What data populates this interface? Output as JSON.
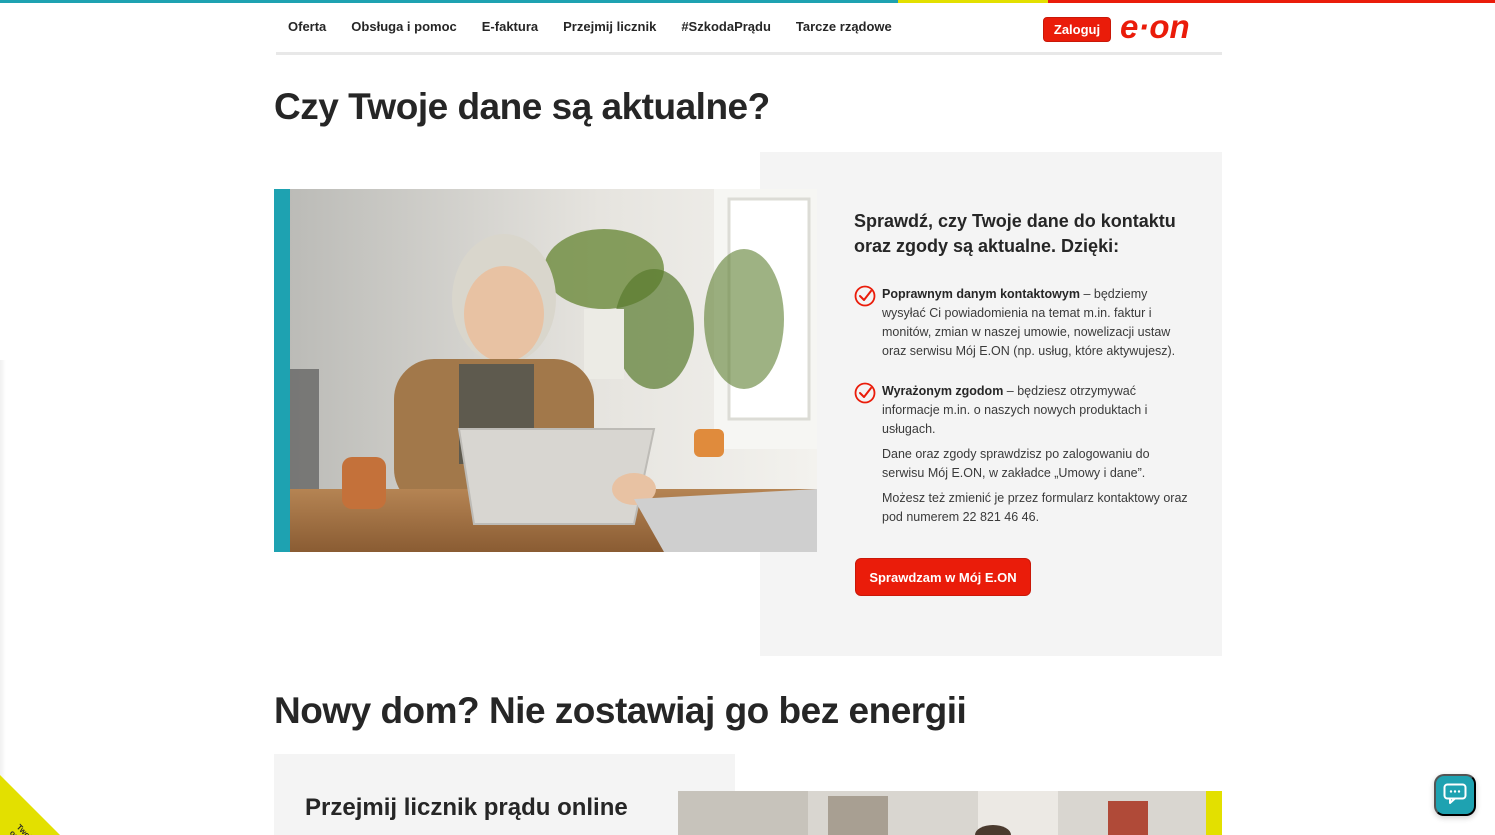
{
  "brand": {
    "logo_text": "e·on",
    "colors": {
      "red": "#ea1c0a",
      "turquoise": "#1ea2b1",
      "yellow": "#e3e000",
      "panel_gray": "#f4f4f4"
    }
  },
  "nav": {
    "items": [
      {
        "label": "Oferta"
      },
      {
        "label": "Obsługa i pomoc"
      },
      {
        "label": "E-faktura"
      },
      {
        "label": "Przejmij licznik"
      },
      {
        "label": "#SzkodaPrądu"
      },
      {
        "label": "Tarcze rządowe"
      }
    ],
    "login_label": "Zaloguj"
  },
  "section1": {
    "heading": "Czy Twoje dane są aktualne?",
    "panel_title": "Sprawdź, czy Twoje dane do kontaktu oraz zgody są aktualne. Dzięki:",
    "bullets": [
      {
        "bold": "Poprawnym danym kontaktowym",
        "text": " – będziemy wysyłać Ci powiadomienia na temat m.in. faktur i monitów, zmian w naszej umowie, nowelizacji ustaw oraz serwisu Mój E.ON (np. usług, które aktywujesz)."
      },
      {
        "bold": "Wyrażonym zgodom",
        "text": " – będziesz otrzymywać informacje m.in. o naszych nowych produktach i usługach."
      }
    ],
    "para1": "Dane oraz zgody sprawdzisz po zalogowaniu do serwisu Mój E.ON, w zakładce „Umowy i dane”.",
    "para2": "Możesz też zmienić je przez formularz kontaktowy oraz pod numerem 22 821 46 46.",
    "cta_label": "Sprawdzam w Mój E.ON"
  },
  "section2": {
    "heading": "Nowy dom? Nie zostawiaj go bez energii",
    "card_title": "Przejmij licznik prądu online"
  },
  "feedback": {
    "label": "Twoja opinia"
  },
  "icons": {
    "check": "check-circle-icon",
    "chat": "chat-icon"
  }
}
